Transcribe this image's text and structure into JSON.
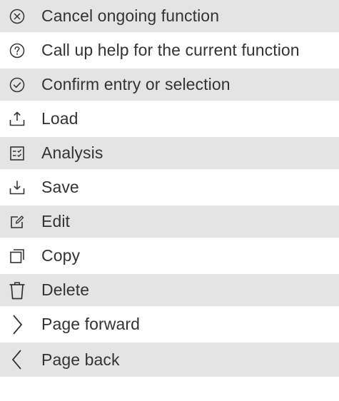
{
  "items": [
    {
      "icon": "cancel-icon",
      "label": "Cancel ongoing function"
    },
    {
      "icon": "help-icon",
      "label": "Call up help for the current function"
    },
    {
      "icon": "confirm-icon",
      "label": "Confirm entry or selection"
    },
    {
      "icon": "load-icon",
      "label": "Load"
    },
    {
      "icon": "analysis-icon",
      "label": "Analysis"
    },
    {
      "icon": "save-icon",
      "label": "Save"
    },
    {
      "icon": "edit-icon",
      "label": "Edit"
    },
    {
      "icon": "copy-icon",
      "label": "Copy"
    },
    {
      "icon": "delete-icon",
      "label": "Delete"
    },
    {
      "icon": "page-forward-icon",
      "label": "Page forward"
    },
    {
      "icon": "page-back-icon",
      "label": "Page back"
    }
  ]
}
